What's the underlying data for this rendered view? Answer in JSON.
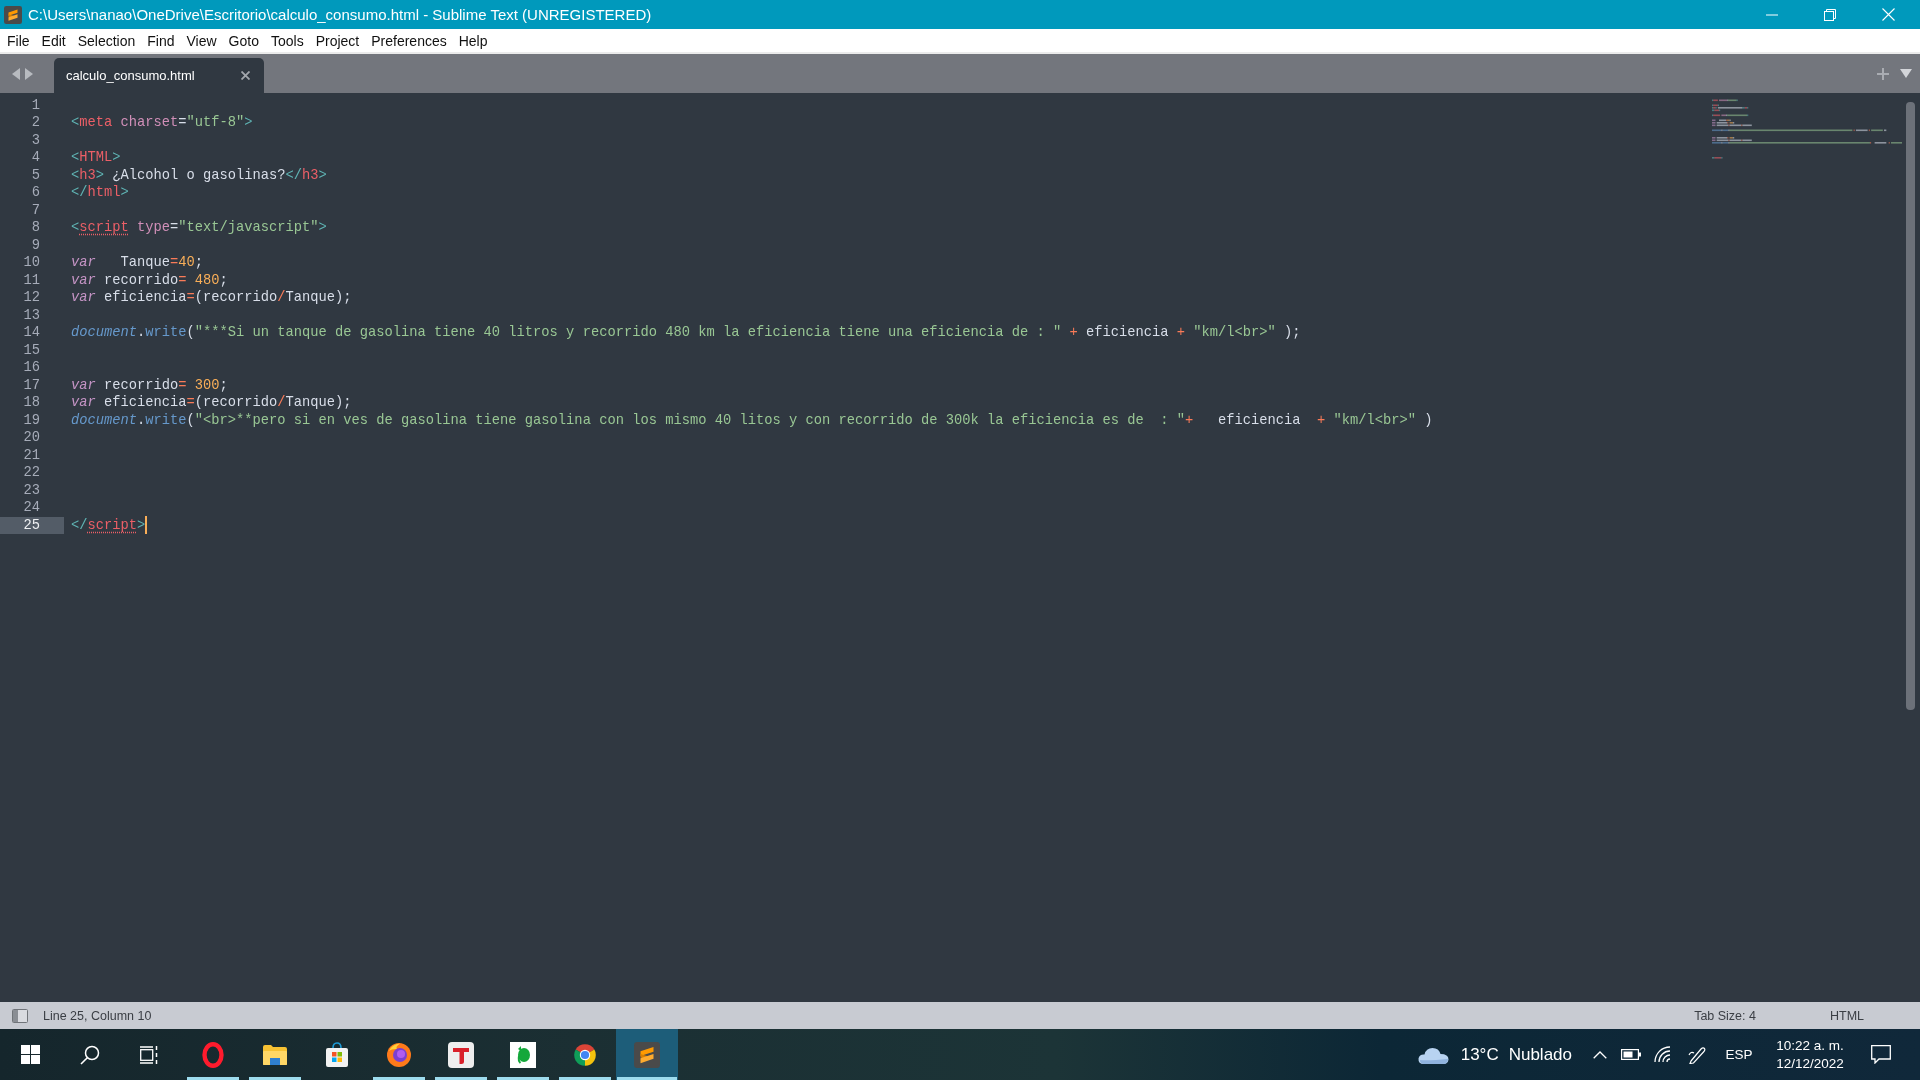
{
  "window": {
    "title": "C:\\Users\\nanao\\OneDrive\\Escritorio\\calculo_consumo.html - Sublime Text (UNREGISTERED)"
  },
  "menu": [
    "File",
    "Edit",
    "Selection",
    "Find",
    "View",
    "Goto",
    "Tools",
    "Project",
    "Preferences",
    "Help"
  ],
  "tabs": [
    {
      "label": "calculo_consumo.html",
      "selected": true
    }
  ],
  "editor": {
    "lines": [
      {
        "number": "1",
        "current": false
      },
      {
        "number": "2",
        "current": false,
        "tokens": [
          {
            "kind": "punct",
            "text": "<"
          },
          {
            "kind": "tag",
            "text": "meta"
          },
          {
            "kind": "attr",
            "text": " charset"
          },
          {
            "kind": "plain",
            "text": "="
          },
          {
            "kind": "string",
            "text": "\"utf-8\""
          },
          {
            "kind": "punct",
            "text": ">"
          }
        ]
      },
      {
        "number": "3",
        "current": false
      },
      {
        "number": "4",
        "current": false,
        "tokens": [
          {
            "kind": "punct",
            "text": "<"
          },
          {
            "kind": "tag",
            "text": "HTML"
          },
          {
            "kind": "punct",
            "text": ">"
          }
        ]
      },
      {
        "number": "5",
        "current": false,
        "tokens": [
          {
            "kind": "punct",
            "text": "<"
          },
          {
            "kind": "tag",
            "text": "h3"
          },
          {
            "kind": "punct",
            "text": ">"
          },
          {
            "kind": "plain",
            "text": " ¿Alcohol o gasolinas?"
          },
          {
            "kind": "punct",
            "text": "</"
          },
          {
            "kind": "tag",
            "text": "h3"
          },
          {
            "kind": "punct",
            "text": ">"
          }
        ]
      },
      {
        "number": "6",
        "current": false,
        "tokens": [
          {
            "kind": "punct",
            "text": "</"
          },
          {
            "kind": "tag",
            "text": "html"
          },
          {
            "kind": "punct",
            "text": ">"
          }
        ]
      },
      {
        "number": "7",
        "current": false
      },
      {
        "number": "8",
        "current": false,
        "tokens": [
          {
            "kind": "punct",
            "text": "<"
          },
          {
            "kind": "misspelled",
            "text": "script"
          },
          {
            "kind": "attr",
            "text": " type"
          },
          {
            "kind": "plain",
            "text": "="
          },
          {
            "kind": "string",
            "text": "\"text/javascript\""
          },
          {
            "kind": "punct",
            "text": ">"
          }
        ]
      },
      {
        "number": "9",
        "current": false
      },
      {
        "number": "10",
        "current": false,
        "tokens": [
          {
            "kind": "keyword",
            "text": "var"
          },
          {
            "kind": "plain",
            "text": "   Tanque"
          },
          {
            "kind": "operator",
            "text": "="
          },
          {
            "kind": "number",
            "text": "40"
          },
          {
            "kind": "plain",
            "text": ";"
          }
        ]
      },
      {
        "number": "11",
        "current": false,
        "tokens": [
          {
            "kind": "keyword",
            "text": "var"
          },
          {
            "kind": "plain",
            "text": " recorrido"
          },
          {
            "kind": "operator",
            "text": "="
          },
          {
            "kind": "number",
            "text": " 480"
          },
          {
            "kind": "plain",
            "text": ";"
          }
        ]
      },
      {
        "number": "12",
        "current": false,
        "tokens": [
          {
            "kind": "keyword",
            "text": "var"
          },
          {
            "kind": "plain",
            "text": " eficiencia"
          },
          {
            "kind": "operator",
            "text": "="
          },
          {
            "kind": "plain",
            "text": "(recorrido"
          },
          {
            "kind": "operator",
            "text": "/"
          },
          {
            "kind": "plain",
            "text": "Tanque);"
          }
        ]
      },
      {
        "number": "13",
        "current": false
      },
      {
        "number": "14",
        "current": false,
        "tokens": [
          {
            "kind": "object",
            "text": "document"
          },
          {
            "kind": "plain",
            "text": "."
          },
          {
            "kind": "function",
            "text": "write"
          },
          {
            "kind": "plain",
            "text": "("
          },
          {
            "kind": "string",
            "text": "\"***Si un tanque de gasolina tiene 40 litros y recorrido 480 km la eficiencia tiene una eficiencia de : \""
          },
          {
            "kind": "operator",
            "text": " +"
          },
          {
            "kind": "plain",
            "text": " eficiencia "
          },
          {
            "kind": "operator",
            "text": "+"
          },
          {
            "kind": "string",
            "text": " \"km/l<br>\""
          },
          {
            "kind": "plain",
            "text": " );"
          }
        ]
      },
      {
        "number": "15",
        "current": false
      },
      {
        "number": "16",
        "current": false
      },
      {
        "number": "17",
        "current": false,
        "tokens": [
          {
            "kind": "keyword",
            "text": "var"
          },
          {
            "kind": "plain",
            "text": " recorrido"
          },
          {
            "kind": "operator",
            "text": "="
          },
          {
            "kind": "number",
            "text": " 300"
          },
          {
            "kind": "plain",
            "text": ";"
          }
        ]
      },
      {
        "number": "18",
        "current": false,
        "tokens": [
          {
            "kind": "keyword",
            "text": "var"
          },
          {
            "kind": "plain",
            "text": " eficiencia"
          },
          {
            "kind": "operator",
            "text": "="
          },
          {
            "kind": "plain",
            "text": "(recorrido"
          },
          {
            "kind": "operator",
            "text": "/"
          },
          {
            "kind": "plain",
            "text": "Tanque);"
          }
        ]
      },
      {
        "number": "19",
        "current": false,
        "tokens": [
          {
            "kind": "object",
            "text": "document"
          },
          {
            "kind": "plain",
            "text": "."
          },
          {
            "kind": "function",
            "text": "write"
          },
          {
            "kind": "plain",
            "text": "("
          },
          {
            "kind": "string",
            "text": "\"<br>**pero si en ves de gasolina tiene gasolina con los mismo 40 litos y con recorrido de 300k la eficiencia es de  : \""
          },
          {
            "kind": "operator",
            "text": "+"
          },
          {
            "kind": "plain",
            "text": "   eficiencia  "
          },
          {
            "kind": "operator",
            "text": "+"
          },
          {
            "kind": "string",
            "text": " \"km/l<br>\""
          },
          {
            "kind": "plain",
            "text": " )"
          }
        ]
      },
      {
        "number": "20",
        "current": false
      },
      {
        "number": "21",
        "current": false
      },
      {
        "number": "22",
        "current": false
      },
      {
        "number": "23",
        "current": false
      },
      {
        "number": "24",
        "current": false
      },
      {
        "number": "25",
        "current": true,
        "tokens": [
          {
            "kind": "punct",
            "text": "</"
          },
          {
            "kind": "misspelled",
            "text": "script"
          },
          {
            "kind": "punct",
            "text": ">"
          }
        ]
      }
    ]
  },
  "status_bar": {
    "position": "Line 25, Column 10",
    "tab_size": "Tab Size: 4",
    "syntax": "HTML"
  },
  "taskbar": {
    "apps": [
      {
        "kind": "ring",
        "running": true,
        "selected": false
      },
      {
        "kind": "folder",
        "running": true,
        "selected": false
      },
      {
        "kind": "bag",
        "running": false,
        "selected": false
      },
      {
        "kind": "orb",
        "running": true,
        "selected": false
      },
      {
        "kind": "tee",
        "running": true,
        "selected": false
      },
      {
        "kind": "blob",
        "running": true,
        "selected": false
      },
      {
        "kind": "segmented",
        "running": true,
        "selected": false
      },
      {
        "kind": "stripes",
        "running": true,
        "selected": true
      }
    ],
    "weather": {
      "temperature": "13°C",
      "condition": "Nublado"
    },
    "language": "ESP",
    "time": "10:22 a. m.",
    "date": "12/12/2022"
  }
}
